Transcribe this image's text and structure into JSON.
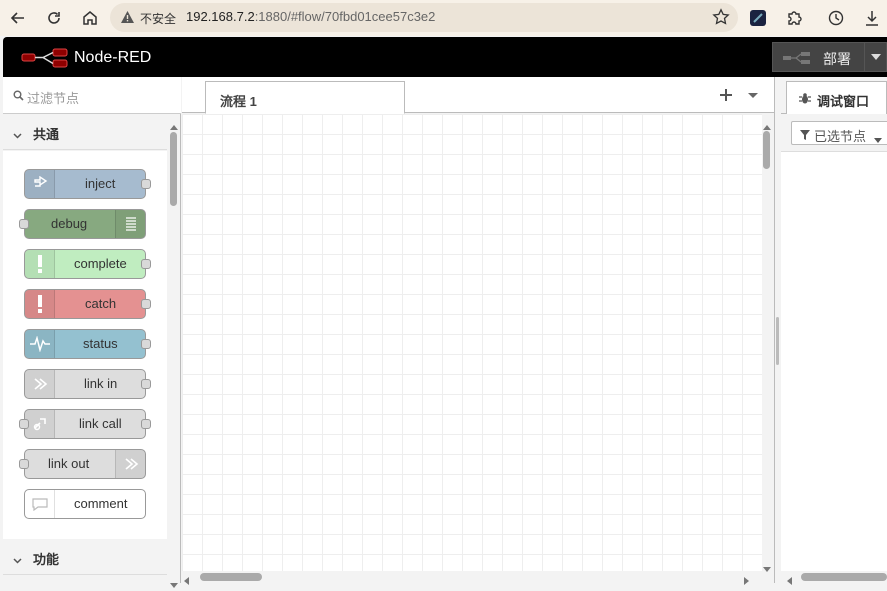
{
  "browser": {
    "insecure_label": "不安全",
    "url_host": "192.168.7.2",
    "url_rest": ":1880/#flow/70fbd01cee57c3e2"
  },
  "header": {
    "title": "Node-RED",
    "deploy_label": "部署"
  },
  "palette": {
    "filter_placeholder": "过滤节点",
    "categories": [
      {
        "label": "共通"
      },
      {
        "label": "功能"
      }
    ],
    "nodes": [
      {
        "label": "inject",
        "color": "#a6bbcf"
      },
      {
        "label": "debug",
        "color": "#87a980"
      },
      {
        "label": "complete",
        "color": "#c0edc0"
      },
      {
        "label": "catch",
        "color": "#e49191"
      },
      {
        "label": "status",
        "color": "#94c1d0"
      },
      {
        "label": "link in",
        "color": "#dddddd"
      },
      {
        "label": "link call",
        "color": "#dddddd"
      },
      {
        "label": "link out",
        "color": "#dddddd"
      },
      {
        "label": "comment",
        "color": "#ffffff"
      }
    ]
  },
  "workspace": {
    "tab_label": "流程 1"
  },
  "sidebar": {
    "tab_label": "调试窗口",
    "filter_label": "已选节点"
  }
}
